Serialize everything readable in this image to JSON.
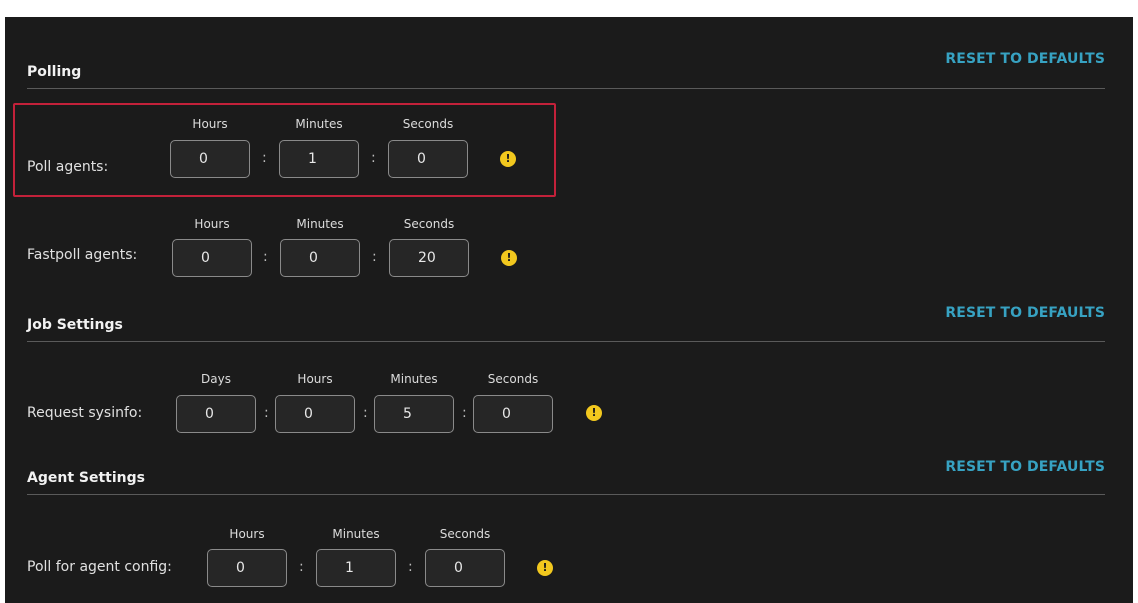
{
  "sections": [
    {
      "title": "Polling",
      "reset_label": "RESET TO DEFAULTS"
    },
    {
      "title": "Job Settings",
      "reset_label": "RESET TO DEFAULTS"
    },
    {
      "title": "Agent Settings",
      "reset_label": "RESET TO DEFAULTS"
    }
  ],
  "rows": [
    {
      "label": "Poll agents:",
      "units": [
        "Hours",
        "Minutes",
        "Seconds"
      ],
      "values": [
        "0",
        "1",
        "0"
      ],
      "separator": ":",
      "warning_icon": "exclamation-icon"
    },
    {
      "label": "Fastpoll agents:",
      "units": [
        "Hours",
        "Minutes",
        "Seconds"
      ],
      "values": [
        "0",
        "0",
        "20"
      ],
      "separator": ":",
      "warning_icon": "exclamation-icon"
    },
    {
      "label": "Request sysinfo:",
      "units": [
        "Days",
        "Hours",
        "Minutes",
        "Seconds"
      ],
      "values": [
        "0",
        "0",
        "5",
        "0"
      ],
      "separator": ":",
      "warning_icon": "exclamation-icon"
    },
    {
      "label": "Poll for agent config:",
      "units": [
        "Hours",
        "Minutes",
        "Seconds"
      ],
      "values": [
        "0",
        "1",
        "0"
      ],
      "separator": ":",
      "warning_icon": "exclamation-icon"
    }
  ],
  "warning_glyph": "!",
  "colors": {
    "background": "#1b1b1b",
    "accent_link": "#37a2c2",
    "warning": "#f2c81e",
    "highlight_border": "#c3213a"
  }
}
